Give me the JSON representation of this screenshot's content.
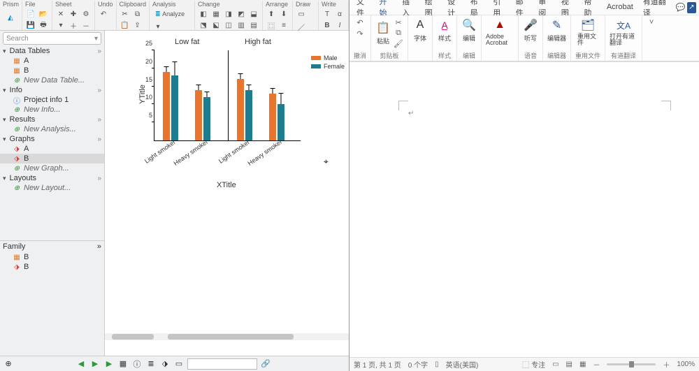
{
  "prism": {
    "menu": [
      "Prism",
      "File",
      "Sheet",
      "Undo",
      "Clipboard",
      "Analysis",
      "Change",
      "Arrange",
      "Draw",
      "Write"
    ],
    "analyze_btn": "Analyze",
    "search_placeholder": "Search",
    "sections": {
      "data_tables": {
        "label": "Data Tables",
        "items": [
          "A",
          "B"
        ],
        "new": "New Data Table..."
      },
      "info": {
        "label": "Info",
        "items": [
          "Project info 1"
        ],
        "new": "New Info..."
      },
      "results": {
        "label": "Results",
        "new": "New Analysis..."
      },
      "graphs": {
        "label": "Graphs",
        "items": [
          "A",
          "B"
        ],
        "new": "New Graph..."
      },
      "layouts": {
        "label": "Layouts",
        "new": "New Layout..."
      }
    },
    "family": {
      "label": "Family",
      "items": [
        "B",
        "B"
      ]
    }
  },
  "chart_data": {
    "type": "bar",
    "groups": [
      "Low fat",
      "High fat"
    ],
    "categories": [
      "Light smoker",
      "Heavy smoker"
    ],
    "series": [
      {
        "name": "Male",
        "color": "#e8742e",
        "values": [
          [
            19,
            14
          ],
          [
            17,
            13
          ]
        ],
        "errors": [
          [
            2,
            2
          ],
          [
            2,
            2
          ]
        ]
      },
      {
        "name": "Female",
        "color": "#1b7d8e",
        "values": [
          [
            18,
            12
          ],
          [
            14,
            10
          ]
        ],
        "errors": [
          [
            5,
            2
          ],
          [
            2,
            4
          ]
        ]
      }
    ],
    "ytitle": "YTitle",
    "xtitle": "XTitle",
    "ylim": [
      0,
      25
    ],
    "yticks": [
      5,
      10,
      15,
      20,
      25
    ]
  },
  "word": {
    "tabs": [
      "文件",
      "开始",
      "插入",
      "绘图",
      "设计",
      "布局",
      "引用",
      "邮件",
      "审阅",
      "视图",
      "帮助",
      "Acrobat",
      "有道翻译"
    ],
    "ribbon": {
      "undo_grp": "撤消",
      "clipboard_grp": "剪贴板",
      "paste": "粘贴",
      "font_grp": "",
      "font_btn": "字体",
      "style_grp": "样式",
      "style_btn": "样式",
      "edit_grp": "编辑",
      "edit_btn": "编辑",
      "adobe_grp": "",
      "adobe_btn": "Adobe Acrobat",
      "voice_grp": "语音",
      "voice_btn": "听写",
      "editor_grp": "编辑器",
      "editor_btn": "编辑器",
      "reuse_grp": "重用文件",
      "reuse_btn": "重用文件",
      "youdao_grp": "有道翻译",
      "youdao_btn": "打开有道翻译"
    },
    "status": {
      "page": "第 1 页, 共 1 页",
      "words": "0 个字",
      "lang": "英语(美国)",
      "focus": "专注",
      "zoom": "100%"
    }
  }
}
